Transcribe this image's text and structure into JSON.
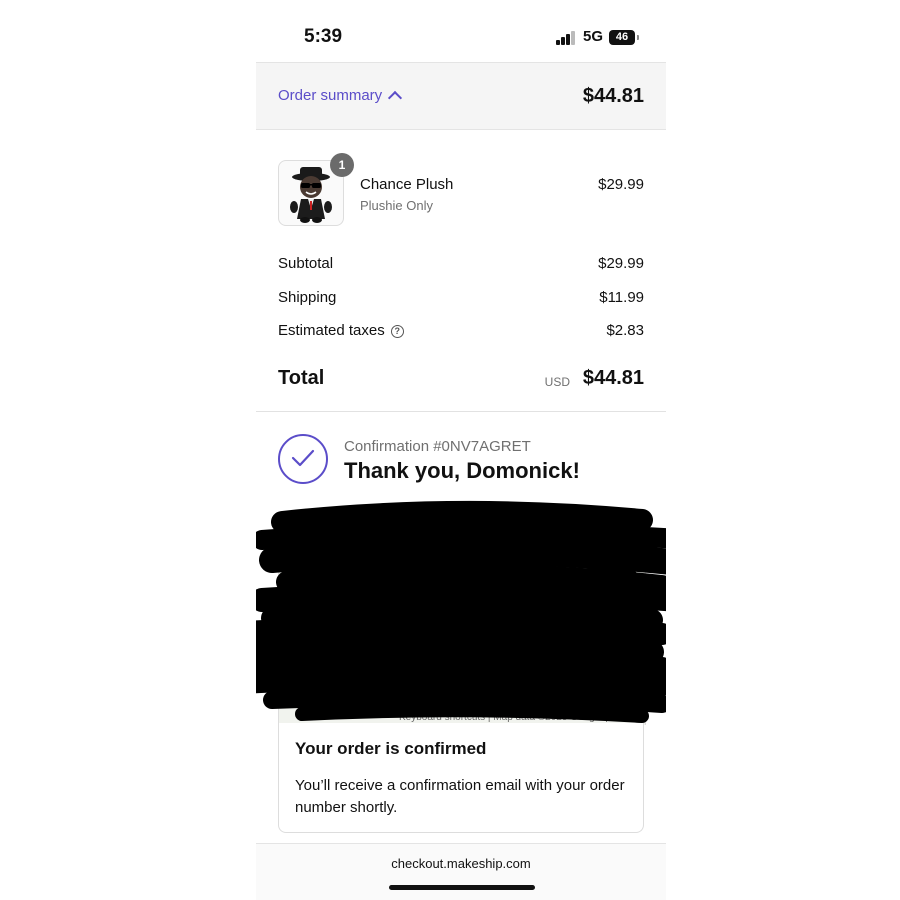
{
  "status_bar": {
    "time": "5:39",
    "network": "5G",
    "battery": "46"
  },
  "summary": {
    "toggle_label": "Order summary",
    "total": "$44.81"
  },
  "product": {
    "quantity": "1",
    "name": "Chance Plush",
    "variant": "Plushie Only",
    "price": "$29.99",
    "icon": "plush-toy-image"
  },
  "lines": [
    {
      "label": "Subtotal",
      "value": "$29.99"
    },
    {
      "label": "Shipping",
      "value": "$11.99"
    },
    {
      "label": "Estimated taxes",
      "value": "$2.83"
    }
  ],
  "total": {
    "label": "Total",
    "currency": "USD",
    "value": "$44.81"
  },
  "confirmation": {
    "number": "Confirmation #0NV7AGRET",
    "thanks": "Thank you, Domonick!"
  },
  "map": {
    "attribution": "Keyboard shortcuts | Map data ©2025 Google | Terms"
  },
  "order_box": {
    "title": "Your order is confirmed",
    "message": "You’ll receive a confirmation email with your order number shortly."
  },
  "browser": {
    "url": "checkout.makeship.com"
  },
  "colors": {
    "accent": "#5b4dc9",
    "summary_bg": "#f5f5f5",
    "redaction": "#000000"
  }
}
